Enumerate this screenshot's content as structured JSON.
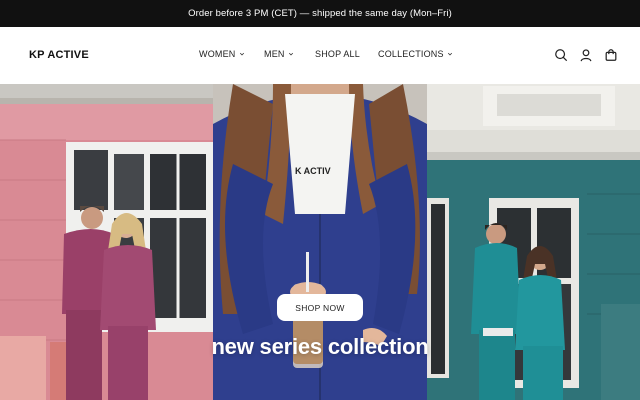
{
  "announcement": "Order before 3 PM (CET) — shipped the same day (Mon–Fri)",
  "header": {
    "logo": "KP ACTIVE",
    "nav": [
      {
        "label": "WOMEN",
        "dropdown": true
      },
      {
        "label": "MEN",
        "dropdown": true
      },
      {
        "label": "SHOP ALL",
        "dropdown": false
      },
      {
        "label": "COLLECTIONS",
        "dropdown": true
      }
    ],
    "icons": [
      "search-icon",
      "account-icon",
      "cart-icon"
    ]
  },
  "hero": {
    "title": "new series collection",
    "cta": "SHOP NOW",
    "panels": [
      {
        "subject": "couple in pink sweatsuits by pink wall",
        "color": "#d98a94"
      },
      {
        "subject": "woman in navy hoodie holding iced coffee",
        "color": "#2e3f8f"
      },
      {
        "subject": "couple in teal sweatsuits by teal wall",
        "color": "#2d6f74"
      }
    ]
  }
}
